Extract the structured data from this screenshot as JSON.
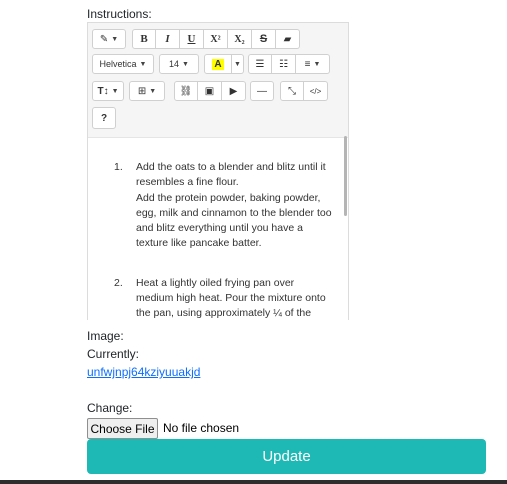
{
  "instructions_label": "Instructions:",
  "toolbar": {
    "style": "✎",
    "bold": "B",
    "italic": "I",
    "underline": "U",
    "superscript": "X²",
    "subscript": "X₂",
    "strikethrough": "S",
    "eraser": "▰",
    "font_family": "Helvetica",
    "font_size": "14",
    "color_letter": "A",
    "unordered_list": "☰",
    "ordered_list": "☷",
    "paragraph": "≡",
    "line_height": "T↕",
    "table": "⊞",
    "link": "⛓",
    "picture": "▣",
    "video": "▶",
    "hr": "—",
    "fullscreen": "⤡",
    "codeview": "</>",
    "help": "?"
  },
  "editor_items": [
    {
      "num": "1.",
      "line1": "Add the oats to a blender and blitz until it resembles a fine flour.",
      "line2": "Add the protein powder, baking powder, egg, milk and cinnamon to the blender too and blitz everything until you have a texture like pancake batter."
    },
    {
      "num": "2.",
      "line1": "Heat a lightly oiled frying pan over medium high heat. Pour the mixture onto the pan, using approximately ¼ of the"
    }
  ],
  "image_label": "Image:",
  "currently_label": "Currently:",
  "current_file": "unfwjnpj64kziyuuakjd",
  "change_label": "Change:",
  "choose_file": "Choose File",
  "no_file": "No file chosen",
  "update": "Update"
}
